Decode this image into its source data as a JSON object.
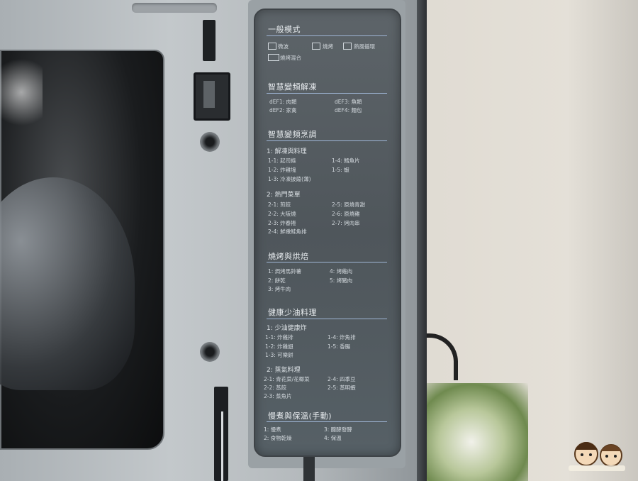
{
  "panel": {
    "general": {
      "title": "一般模式",
      "items": [
        "微波",
        "燒烤",
        "熱風循環",
        "燒烤混合"
      ]
    },
    "defrost": {
      "title": "智慧變頻解凍",
      "items": [
        "dEF1: 肉類",
        "dEF2: 家禽",
        "dEF3: 魚類",
        "dEF4: 麵包"
      ]
    },
    "cook": {
      "title": "智慧變頻烹調",
      "group1": {
        "title": "1: 解凍與料理",
        "items": [
          "1-1: 起司條",
          "1-2: 炸雞塊",
          "1-3: 冷凍披薩(薄)",
          "1-4: 鱈魚片",
          "1-5: 蝦"
        ]
      },
      "group2": {
        "title": "2: 熱門菜單",
        "items": [
          "2-1: 煎餃",
          "2-2: 大阪燒",
          "2-3: 炸春捲",
          "2-4: 鮮嫩鮭魚排",
          "2-5: 原燒青甜",
          "2-6: 原燒雞",
          "2-7: 烤肉串"
        ]
      }
    },
    "bake": {
      "title": "燒烤與烘焙",
      "items": [
        "1: 焗烤馬鈴薯",
        "2: 餅乾",
        "3: 烤牛肉",
        "4: 烤雞肉",
        "5: 烤豬肉"
      ]
    },
    "healthy": {
      "title": "健康少油料理",
      "group1": {
        "title": "1: 少油健康炸",
        "items": [
          "1-1: 炸雞排",
          "1-2: 炸雞翅",
          "1-3: 可樂餅",
          "1-4: 炸魚排",
          "1-5: 香腸"
        ]
      },
      "group2": {
        "title": "2: 蒸氣料理",
        "items": [
          "2-1: 青花菜/花椰菜",
          "2-2: 蒸餃",
          "2-3: 蒸魚片",
          "2-4: 四季豆",
          "2-5: 蒸明蝦"
        ]
      }
    },
    "warm": {
      "title": "慢煮與保溫(手動)",
      "items": [
        "1: 慢煮",
        "2: 食物乾燥",
        "3: 醱酵發酵",
        "4: 保溫"
      ]
    }
  }
}
